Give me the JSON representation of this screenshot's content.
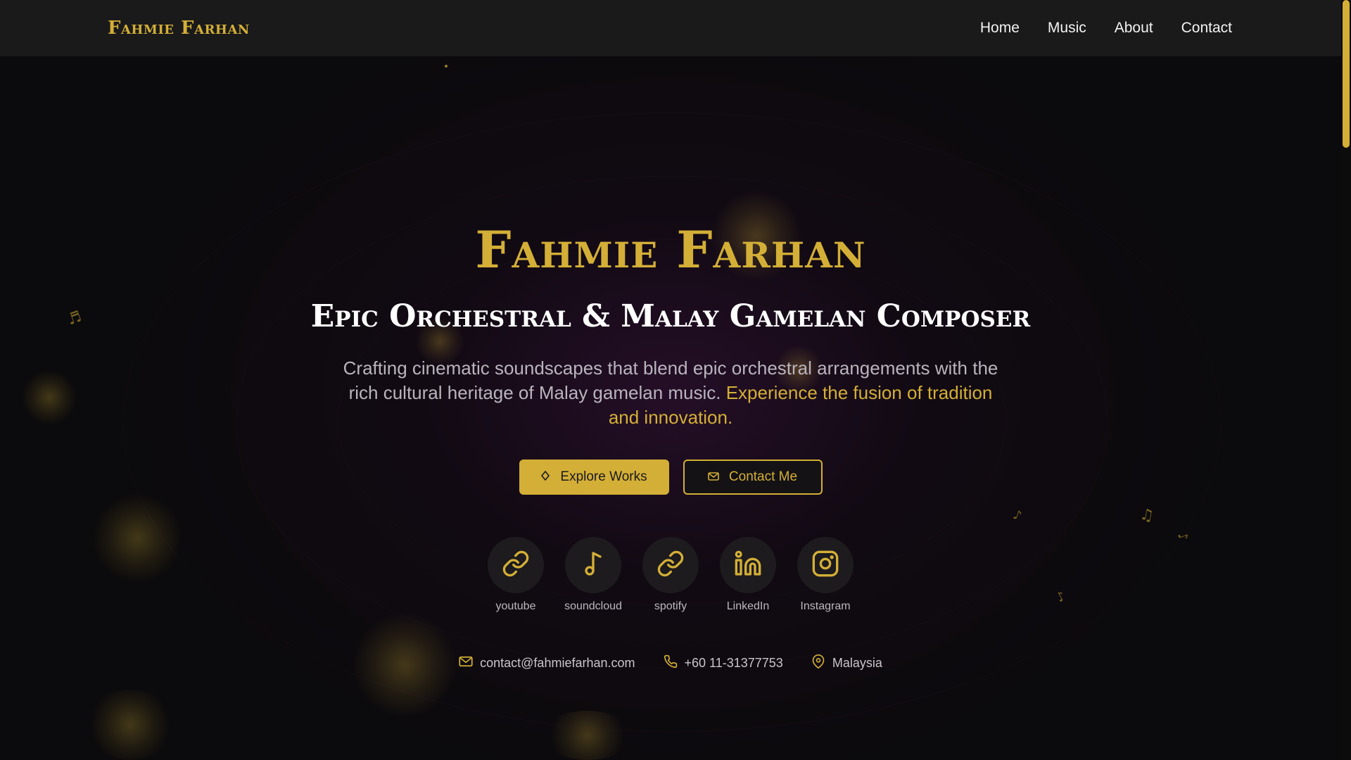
{
  "header": {
    "brand": "Fahmie Farhan",
    "nav": [
      {
        "label": "Home"
      },
      {
        "label": "Music"
      },
      {
        "label": "About"
      },
      {
        "label": "Contact"
      }
    ]
  },
  "hero": {
    "title": "Fahmie Farhan",
    "subtitle": "Epic Orchestral & Malay Gamelan Composer",
    "description": "Crafting cinematic soundscapes that blend epic orchestral arrangements with the rich cultural heritage of Malay gamelan music. ",
    "description_accent": "Experience the fusion of tradition and innovation.",
    "buttons": {
      "primary": {
        "label": "Explore Works",
        "icon": "diamond-icon"
      },
      "secondary": {
        "label": "Contact Me",
        "icon": "mail-icon"
      }
    }
  },
  "social": [
    {
      "label": "youtube",
      "icon": "link-icon"
    },
    {
      "label": "soundcloud",
      "icon": "music-note-icon"
    },
    {
      "label": "spotify",
      "icon": "link-icon"
    },
    {
      "label": "LinkedIn",
      "icon": "linkedin-icon"
    },
    {
      "label": "Instagram",
      "icon": "instagram-icon"
    }
  ],
  "contact": {
    "email": "contact@fahmiefarhan.com",
    "phone": "+60 11-31377753",
    "location": "Malaysia"
  },
  "colors": {
    "accent": "#d4af37",
    "background": "#0b0a0c",
    "header": "#1a1a1b"
  }
}
